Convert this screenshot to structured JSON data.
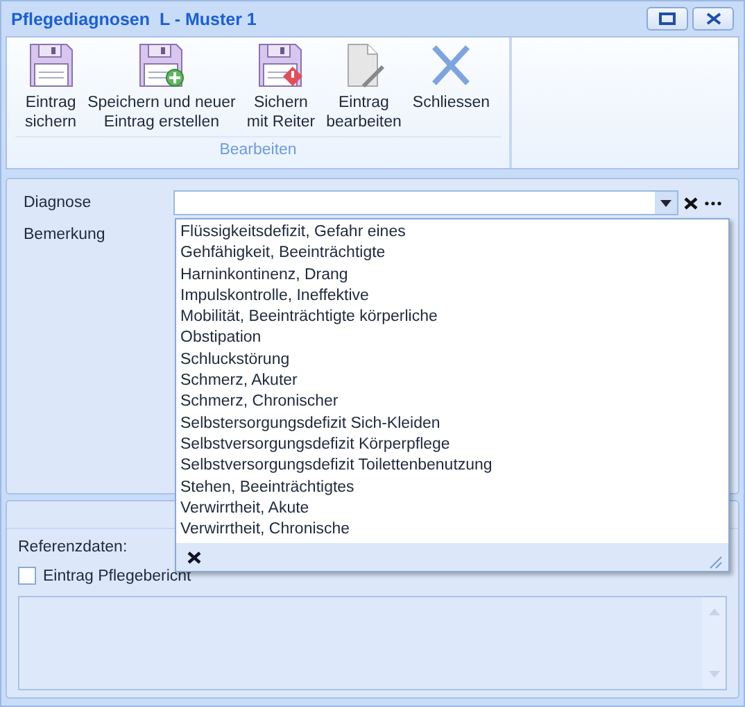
{
  "window": {
    "title": "Pflegediagnosen  L - Muster 1"
  },
  "ribbon": {
    "group": "Bearbeiten",
    "buttons": [
      {
        "label": "Eintrag\nsichern",
        "kind": "save"
      },
      {
        "label": "Speichern und neuer\nEintrag erstellen",
        "kind": "save-new"
      },
      {
        "label": "Sichern\nmit Reiter",
        "kind": "save-warn"
      },
      {
        "label": "Eintrag\nbearbeiten",
        "kind": "edit"
      },
      {
        "label": "Schliessen",
        "kind": "close"
      }
    ]
  },
  "form": {
    "diagnose_label": "Diagnose",
    "bemerkung_label": "Bemerkung",
    "reference_label": "Referenzdaten:",
    "checkbox": {
      "label": "Eintrag Pflegebericht",
      "checked": false
    }
  },
  "dropdown": {
    "items": [
      "Flüssigkeitsdefizit, Gefahr eines",
      "Gehfähigkeit, Beeinträchtigte",
      "Harninkontinenz, Drang",
      "Impulskontrolle, Ineffektive",
      "Mobilität, Beeinträchtigte körperliche",
      "Obstipation",
      "Schluckstörung",
      "Schmerz, Akuter",
      "Schmerz, Chronischer",
      "Selbstersorgungsdefizit Sich-Kleiden",
      "Selbstversorgungsdefizit Körperpflege",
      "Selbstversorgungsdefizit Toilettenbenutzung",
      "Stehen, Beeinträchtigtes",
      "Verwirrtheit, Akute",
      "Verwirrtheit, Chronische"
    ]
  }
}
